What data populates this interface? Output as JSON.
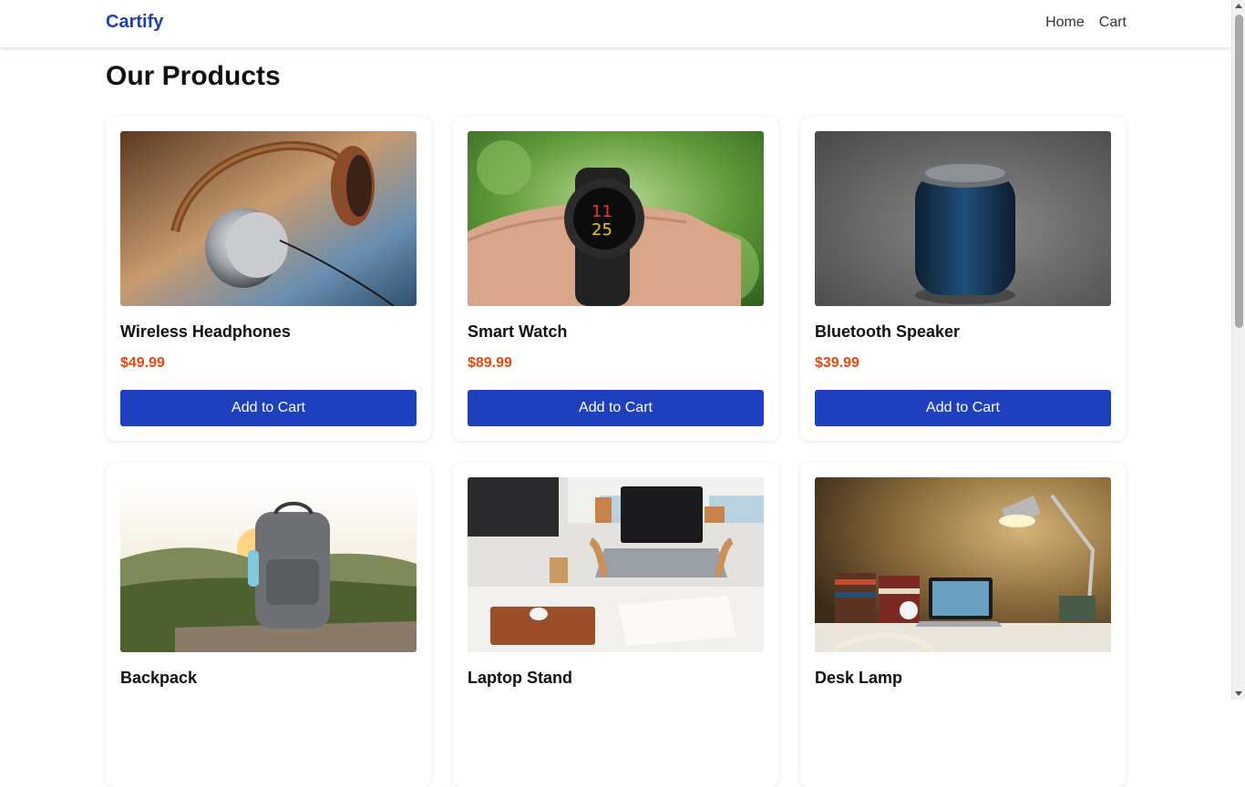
{
  "nav": {
    "brand": "Cartify",
    "links": [
      "Home",
      "Cart"
    ]
  },
  "page": {
    "title": "Our Products"
  },
  "products": [
    {
      "name": "Wireless Headphones",
      "price": "$49.99",
      "button": "Add to Cart",
      "image": "headphones-photo"
    },
    {
      "name": "Smart Watch",
      "price": "$89.99",
      "button": "Add to Cart",
      "image": "smartwatch-photo"
    },
    {
      "name": "Bluetooth Speaker",
      "price": "$39.99",
      "button": "Add to Cart",
      "image": "speaker-photo"
    },
    {
      "name": "Backpack",
      "price": "",
      "button": "",
      "image": "backpack-photo"
    },
    {
      "name": "Laptop Stand",
      "price": "",
      "button": "",
      "image": "laptop-stand-photo"
    },
    {
      "name": "Desk Lamp",
      "price": "",
      "button": "",
      "image": "desk-lamp-photo"
    }
  ],
  "colors": {
    "brand": "#1e3fae",
    "button": "#1e3fbe",
    "price": "#e8470c"
  }
}
